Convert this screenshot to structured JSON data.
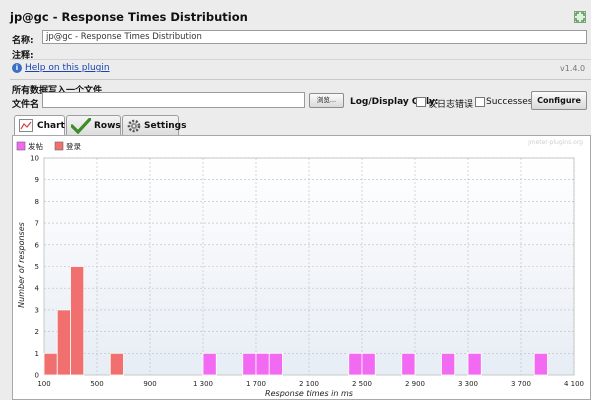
{
  "window": {
    "title": "jp@gc - Response Times Distribution",
    "expand_icon": "expand-icon"
  },
  "form": {
    "name_label": "名称:",
    "name_value": "jp@gc - Response Times Distribution",
    "comment_label": "注释:",
    "help_icon": "info-icon",
    "help_link": "Help on this plugin",
    "version": "v1.4.0"
  },
  "file": {
    "section_title": "所有数据写入一个文件",
    "file_label": "文件名",
    "file_value": "",
    "browse_label": "浏览...",
    "log_display_label": "Log/Display Only:",
    "errors_label": "仅日志错误",
    "errors_checked": false,
    "successes_label": "Successes",
    "successes_checked": false,
    "configure_label": "Configure"
  },
  "tabs": [
    {
      "label": "Chart",
      "icon": "chart-icon",
      "selected": true
    },
    {
      "label": "Rows",
      "icon": "checkmark-icon",
      "selected": false
    },
    {
      "label": "Settings",
      "icon": "gear-icon",
      "selected": false
    }
  ],
  "chart_data": {
    "type": "bar",
    "watermark": "jmeter-plugins.org",
    "xlabel": "Response times in ms",
    "ylabel": "Number of responses",
    "xlim": [
      100,
      4100
    ],
    "ylim": [
      0,
      10
    ],
    "x_ticks": [
      "100",
      "500",
      "900",
      "1 300",
      "1 700",
      "2 100",
      "2 500",
      "2 900",
      "3 300",
      "3 700",
      "4 100"
    ],
    "y_ticks": [
      "0",
      "1",
      "2",
      "3",
      "4",
      "5",
      "6",
      "7",
      "8",
      "9",
      "10"
    ],
    "grid": true,
    "bin_width_ms": 100,
    "legend_position": "top-left",
    "series": [
      {
        "name": "发帖",
        "color": "#f26af2",
        "bins": [
          {
            "x": 1300,
            "y": 1
          },
          {
            "x": 1600,
            "y": 1
          },
          {
            "x": 1700,
            "y": 1
          },
          {
            "x": 1800,
            "y": 1
          },
          {
            "x": 2400,
            "y": 1
          },
          {
            "x": 2500,
            "y": 1
          },
          {
            "x": 2800,
            "y": 1
          },
          {
            "x": 3100,
            "y": 1
          },
          {
            "x": 3300,
            "y": 1
          },
          {
            "x": 3800,
            "y": 1
          }
        ]
      },
      {
        "name": "登录",
        "color": "#f07070",
        "bins": [
          {
            "x": 100,
            "y": 1
          },
          {
            "x": 200,
            "y": 3
          },
          {
            "x": 300,
            "y": 5
          },
          {
            "x": 600,
            "y": 1
          }
        ]
      }
    ]
  }
}
